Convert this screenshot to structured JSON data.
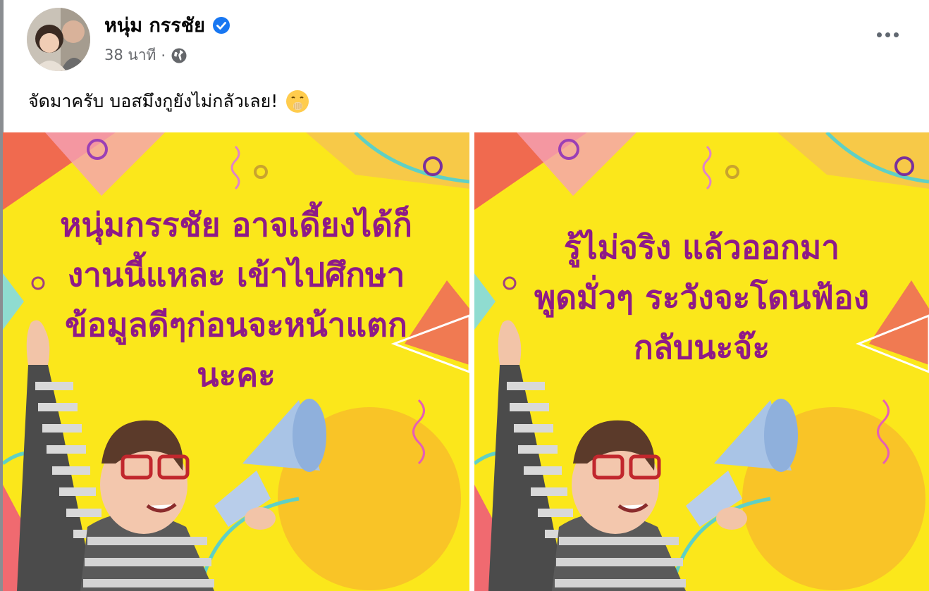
{
  "post": {
    "author_name": "หนุ่ม กรรชัย",
    "verified": true,
    "timestamp": "38 นาที",
    "separator": "·",
    "audience_icon": "globe-icon",
    "more_icon": "more-options-icon",
    "caption": "จัดมาครับ บอสมึงกูยังไม่กลัวเลย!",
    "caption_emoji": "face-with-hand-over-mouth-emoji"
  },
  "images": [
    {
      "lines": [
        "หนุ่มกรรชัย อาจเดี้ยงได้ก็",
        "งานนี้แหละ เข้าไปศึกษา",
        "ข้อมูลดีๆก่อนจะหน้าแตก",
        "นะคะ"
      ]
    },
    {
      "lines": [
        "รู้ไม่จริง แล้วออกมา",
        "พูดมั่วๆ ระวังจะโดนฟ้อง",
        "กลับนะจ๊ะ"
      ]
    }
  ],
  "colors": {
    "image_background": "#fbe71b",
    "image_text": "#8e1a88",
    "verified_badge": "#1877f2",
    "secondary_text": "#65676b"
  }
}
